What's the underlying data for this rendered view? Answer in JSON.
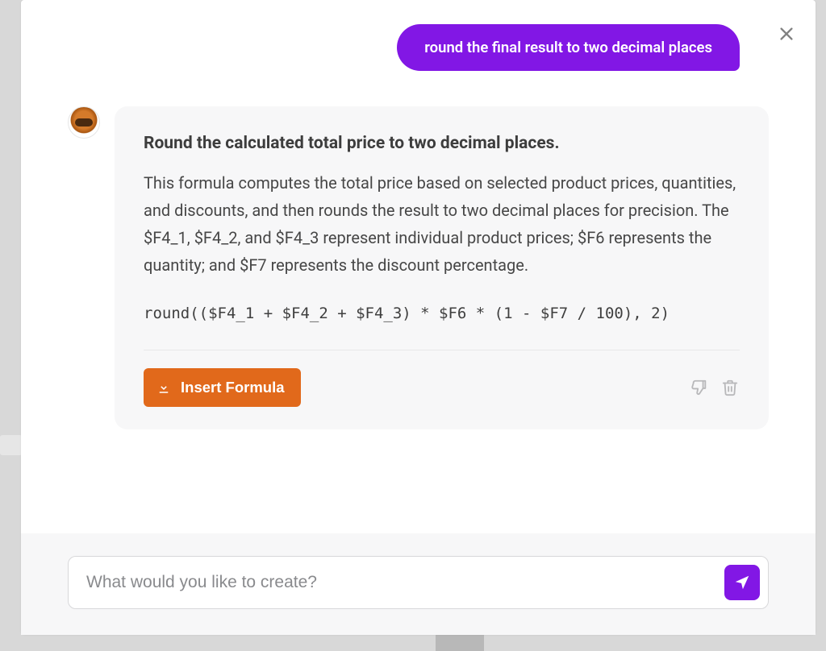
{
  "user_message": "round the final result to two decimal places",
  "assistant": {
    "title": "Round the calculated total price to two decimal places.",
    "body": "This formula computes the total price based on selected product prices, quantities, and discounts, and then rounds the result to two decimal places for precision. The $F4_1, $F4_2, and $F4_3 represent individual product prices; $F6 represents the quantity; and $F7 represents the discount percentage.",
    "formula": "round(($F4_1 + $F4_2 + $F4_3) * $F6 * (1 - $F7 / 100), 2)",
    "insert_label": "Insert Formula"
  },
  "input": {
    "placeholder": "What would you like to create?"
  },
  "colors": {
    "accent": "#8217e5",
    "action": "#e1691b"
  }
}
